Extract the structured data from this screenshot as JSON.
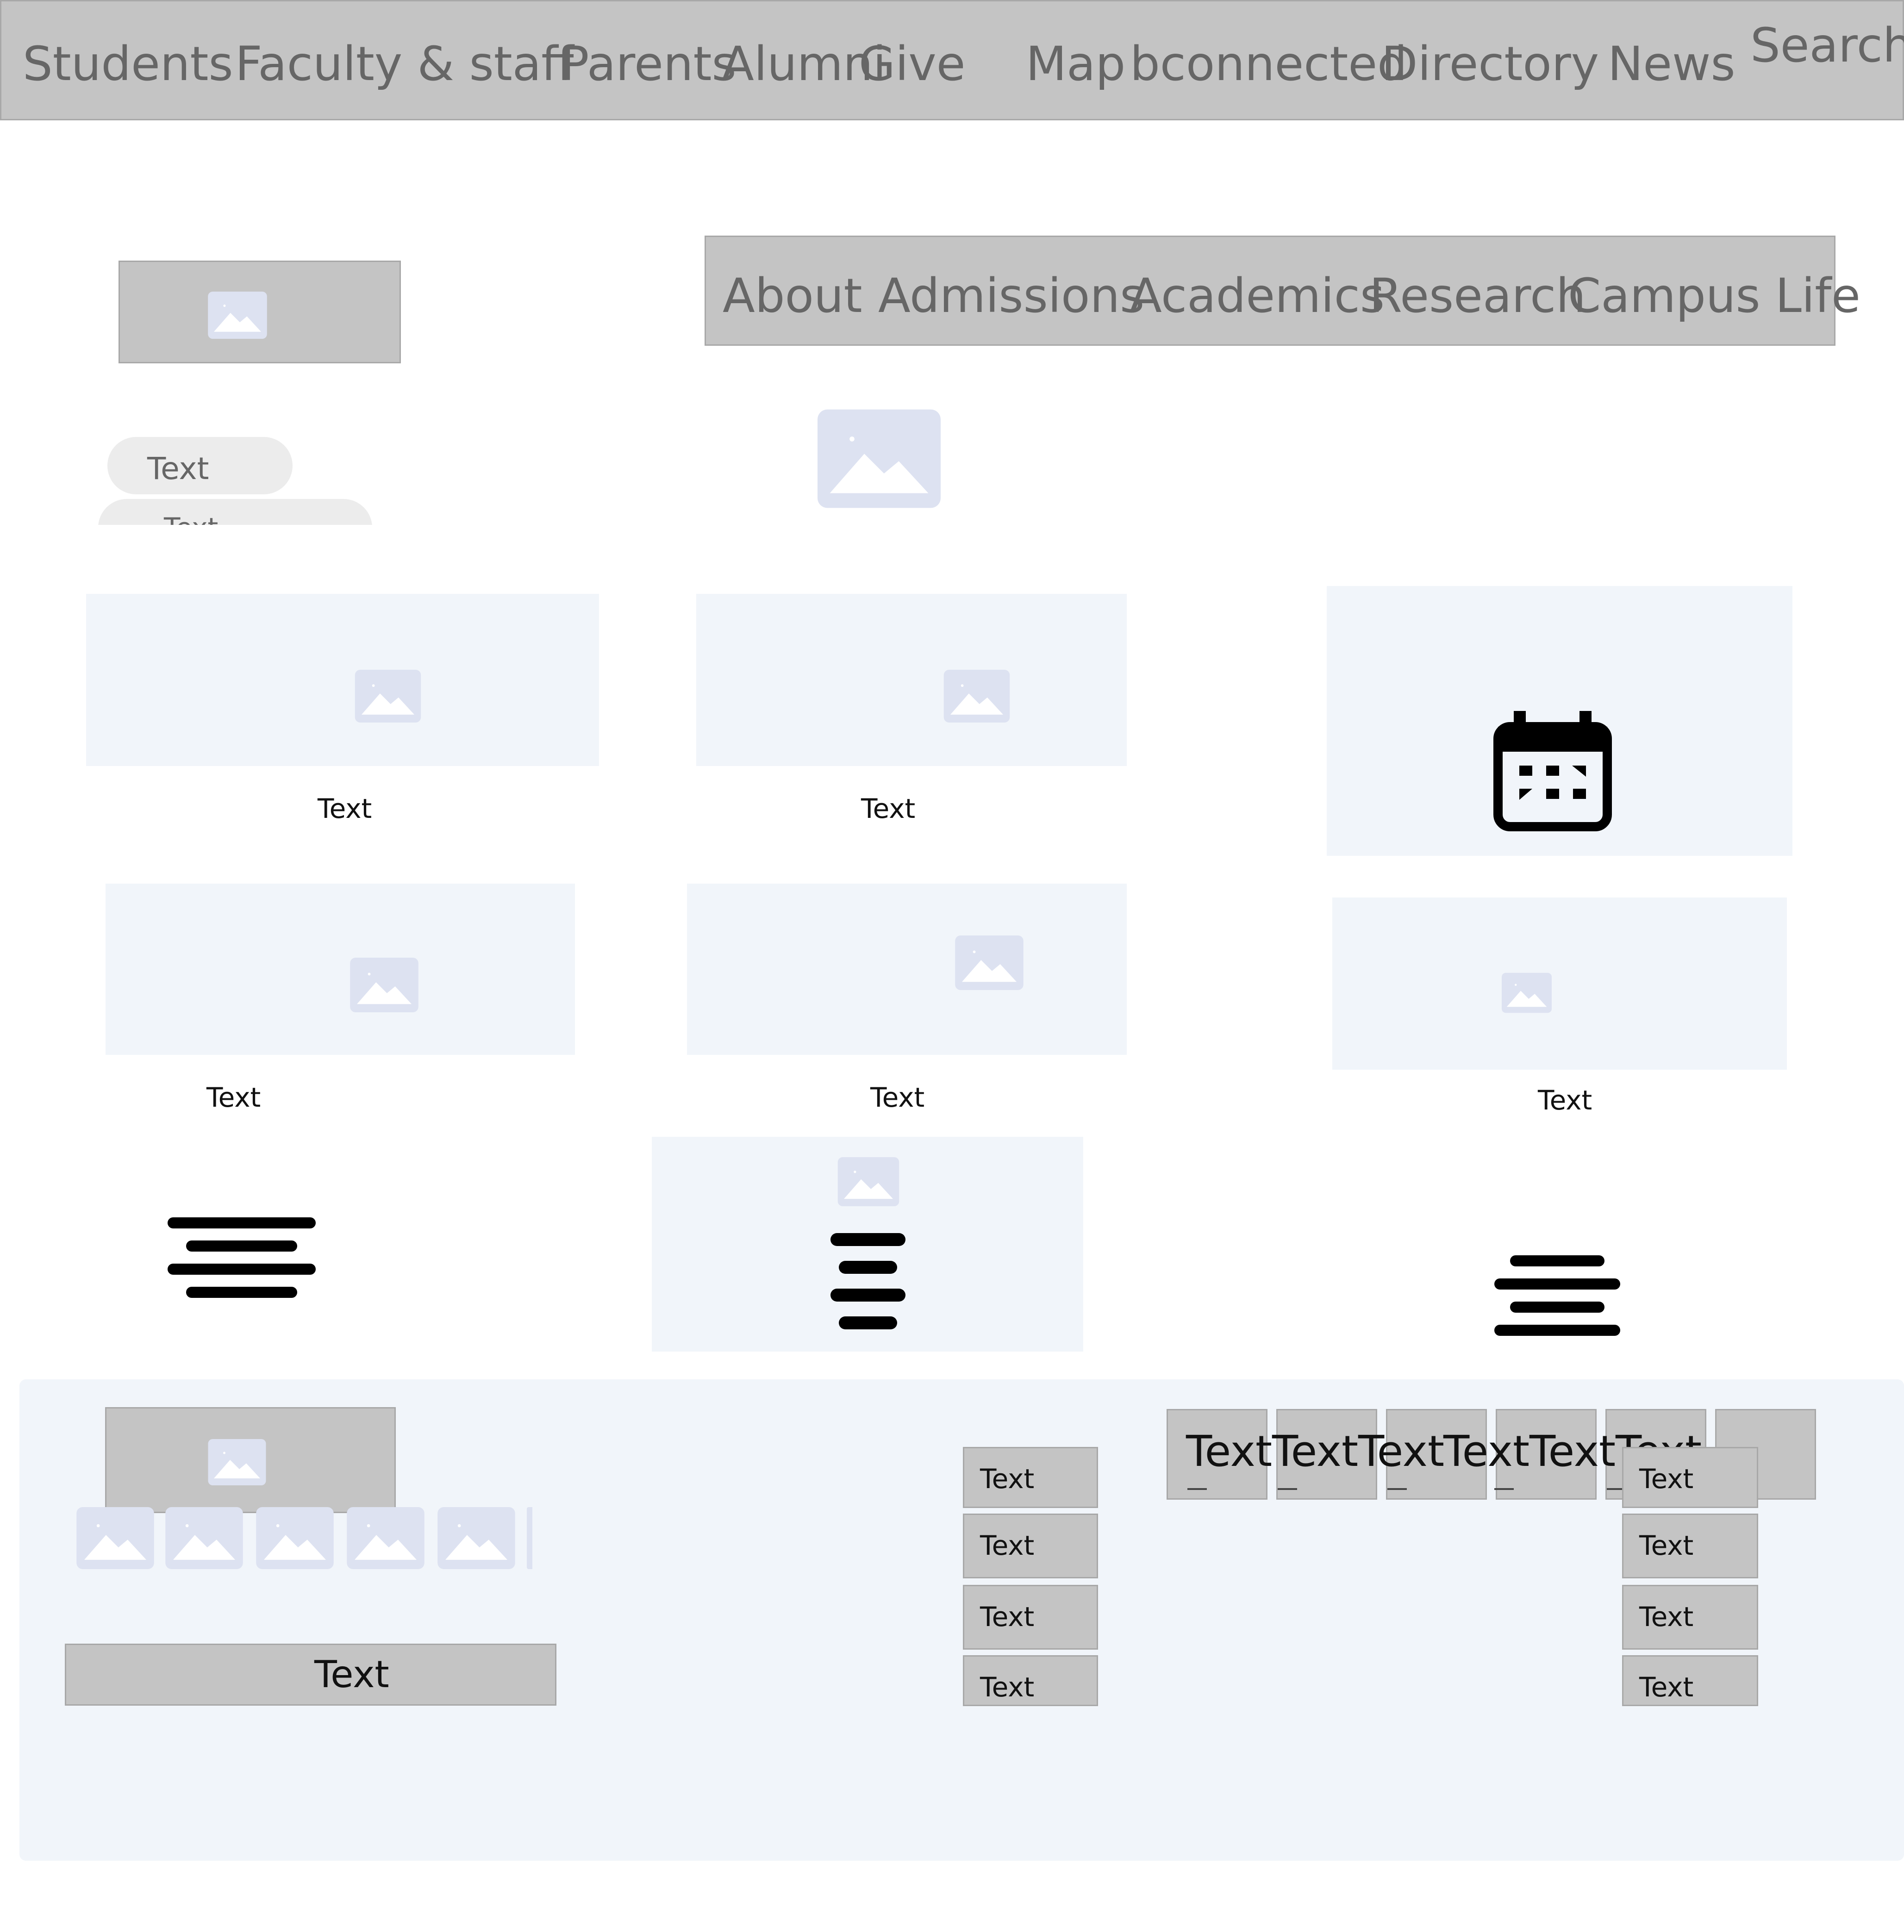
{
  "top_bar": {
    "links": [
      "Students",
      "Faculty & staff",
      "Parents",
      "Alumni",
      "Give",
      "Map",
      "bconnected",
      "Directory",
      "News"
    ],
    "search_label": "Search"
  },
  "main_nav": {
    "items": [
      "About",
      "Admissions",
      "Academics",
      "Research",
      "Campus Life"
    ]
  },
  "pills": [
    "Text",
    "Text"
  ],
  "cards": {
    "row1": [
      "Text",
      "Text"
    ],
    "row2": [
      "Text",
      "Text",
      "Text"
    ]
  },
  "footer": {
    "wide_button_label": "Text",
    "list_left": [
      "Text",
      "Text",
      "Text",
      "Text"
    ],
    "tabs": [
      "Text",
      "Text",
      "Text",
      "Text",
      "Text",
      "Text"
    ],
    "list_right": [
      "Text",
      "Text",
      "Text",
      "Text"
    ]
  },
  "colors": {
    "bar_gray": "#c4c4c4",
    "pale_panel": "#f1f5fa",
    "placeholder_icon": "#dde2f1",
    "nav_text": "#666666"
  },
  "icons": [
    "image-placeholder-icon",
    "calendar-icon",
    "menu-lines-icon"
  ]
}
